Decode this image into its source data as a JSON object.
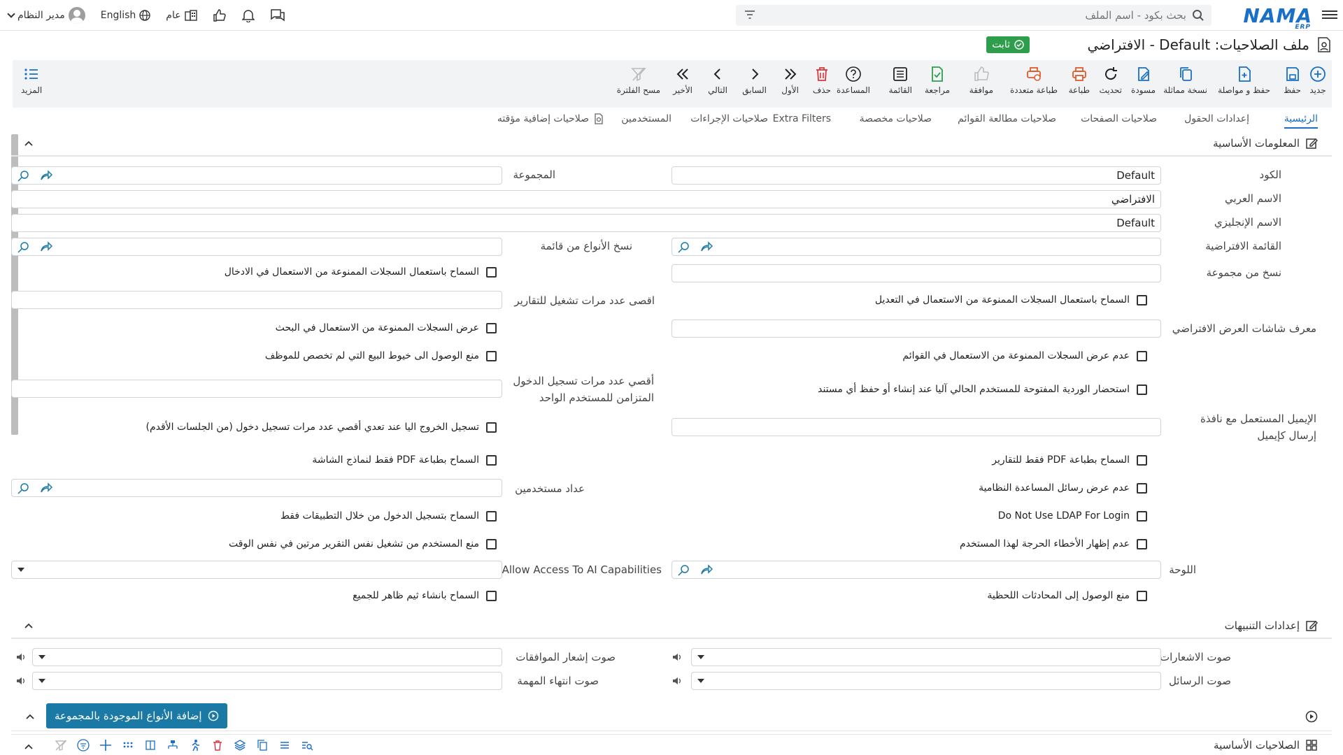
{
  "topbar": {
    "search_placeholder": "بحث بكود - اسم الملف",
    "logo": "NAMA",
    "logo_sub": "ERP",
    "user": "مدير النظام",
    "language": "English",
    "scope": "عام"
  },
  "title": {
    "text": "ملف الصلاحيات: Default - الافتراضي",
    "status": "ثابت"
  },
  "toolbar": {
    "new": "جديد",
    "save": "حفظ",
    "save_continue": "حفظ و مواصلة",
    "duplicate": "نسخة مماثلة",
    "draft": "مسودة",
    "refresh": "تحديث",
    "print": "طباعة",
    "multi_print": "طباعة متعددة",
    "approve": "موافقة",
    "review": "مراجعة",
    "list": "القائمة",
    "help": "المساعدة",
    "delete": "حذف",
    "first": "الأول",
    "prev": "السابق",
    "next": "التالي",
    "last": "الأخير",
    "clear_filter": "مسح الفلترة",
    "more": "المزيد"
  },
  "tabs": [
    "الرئيسية",
    "إعدادات الحقول",
    "صلاحيات الصفحات",
    "صلاحيات مطالعة القوائم",
    "صلاحيات مخصصة",
    "Extra Filters",
    "صلاحيات الإجراءات",
    "المستخدمين",
    "صلاحيات إضافية مؤقته"
  ],
  "sections": {
    "basic": "المعلومات الأساسية",
    "alerts": "إعدادات التنبيهات",
    "add_types": "إضافة الأنواع الموجودة بالمجموعة",
    "basic_perms": "الصلاحيات الأساسية"
  },
  "fields": {
    "code_label": "الكود",
    "code_value": "Default",
    "group_label": "المجموعة",
    "arabic_label": "الاسم العربي",
    "arabic_value": "الافتراضي",
    "english_label": "الاسم الإنجليزي",
    "english_value": "Default",
    "default_list_label": "القائمة الافتراضية",
    "copy_types_label": "نسخ الأنواع من قائمة",
    "copy_group_label": "نسخ من مجموعة",
    "max_reports_label": "اقصى عدد مرات تشغيل للتقارير",
    "default_screen_label": "معرف شاشات العرض الافتراضي",
    "max_logins_label": "أقصي عدد مرات تسجيل الدخول المتزامن للمستخدم الواحد",
    "email_label": "الإيميل المستعمل مع نافذة إرسال كإيميل",
    "users_count_label": "عداد مستخدمين",
    "board_label": "اللوحة",
    "ai_label": "Allow Access To AI Capabilities",
    "notif_sound_label": "صوت الاشعارات",
    "approvals_sound_label": "صوت إشعار الموافقات",
    "messages_sound_label": "صوت الرسائل",
    "task_end_sound_label": "صوت انتهاء المهمة"
  },
  "checks": {
    "allow_blocked_entry": "السماح باستعمال السجلات الممنوعة من الاستعمال في الادخال",
    "allow_blocked_edit": "السماح باستعمال السجلات الممنوعة من الاستعمال في التعديل",
    "show_blocked_search": "عرض السجلات الممنوعة من الاستعمال في البحث",
    "hide_blocked_lists": "عدم عرض السجلات الممنوعة من الاستعمال في القوائم",
    "block_sales_lines": "منع الوصول الى خيوط البيع التي لم تخصص للموظف",
    "fetch_shift": "استحضار الوردية المفتوحة للمستخدم الحالي آليا عند إنشاء أو حفظ أي مستند",
    "auto_logout": "تسجيل الخروج اليا عند تعدي أقصي عدد مرات تسجيل دخول (من الجلسات الأقدم)",
    "pdf_screens": "السماح بطباعة PDF فقط لنماذج الشاشة",
    "pdf_reports": "السماح بطباعة PDF فقط للتقارير",
    "hide_help": "عدم عرض رسائل المساعدة النظامية",
    "apps_login": "السماح بتسجيل الدخول من خلال التطبيقات فقط",
    "no_ldap": "Do Not Use LDAP For Login",
    "same_report": "منع المستخدم من تشغيل نفس التقرير مرتين في نفس الوقت",
    "hide_errors": "عدم إظهار الأخطاء الحرجة لهذا المستخدم",
    "public_theme": "السماح بانشاء ثيم ظاهر للجميع",
    "block_chat": "منع الوصول إلى المحادثات اللحظية"
  }
}
